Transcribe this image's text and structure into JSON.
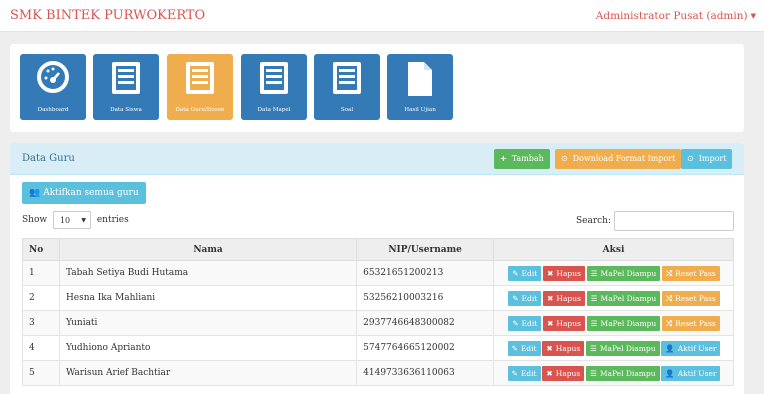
{
  "header": {
    "brand": "SMK BINTEK PURWOKERTO",
    "user": "Administrator Pusat (admin)"
  },
  "tiles": [
    {
      "label": "Dashboard",
      "icon": "dashboard-icon",
      "active": false
    },
    {
      "label": "Data Siswa",
      "icon": "list-icon",
      "active": false
    },
    {
      "label": "Data Guru/Dosen",
      "icon": "list-icon",
      "active": true
    },
    {
      "label": "Data Mapel",
      "icon": "list-icon",
      "active": false
    },
    {
      "label": "Soal",
      "icon": "list-icon",
      "active": false
    },
    {
      "label": "Hasil Ujian",
      "icon": "file-icon",
      "active": false
    }
  ],
  "panel": {
    "title": "Data Guru",
    "tambah": "Tambah",
    "download": "Download Format Import",
    "import": "Import",
    "aktifkan": "Aktifkan semua guru"
  },
  "length": {
    "show": "Show",
    "value": "10",
    "entries": "entries"
  },
  "search": {
    "label": "Search:",
    "value": ""
  },
  "table": {
    "headers": [
      "No",
      "Nama",
      "NIP/Username",
      "Aksi"
    ],
    "rows": [
      {
        "no": "1",
        "nama": "Tabah Setiya Budi Hutama",
        "nip": "65321651200213",
        "actions": [
          "Edit",
          "Hapus",
          "MaPel Diampu",
          "Reset Pass"
        ]
      },
      {
        "no": "2",
        "nama": "Hesna Ika Mahliani",
        "nip": "53256210003216",
        "actions": [
          "Edit",
          "Hapus",
          "MaPel Diampu",
          "Reset Pass"
        ]
      },
      {
        "no": "3",
        "nama": "Yuniati",
        "nip": "2937746648300082",
        "actions": [
          "Edit",
          "Hapus",
          "MaPel Diampu",
          "Reset Pass"
        ]
      },
      {
        "no": "4",
        "nama": "Yudhiono Aprianto",
        "nip": "5747764665120002",
        "actions": [
          "Edit",
          "Hapus",
          "MaPel Diampu",
          "Aktif User"
        ]
      },
      {
        "no": "5",
        "nama": "Warisun Arief Bachtiar",
        "nip": "4149733636110063",
        "actions": [
          "Edit",
          "Hapus",
          "MaPel Diampu",
          "Aktif User"
        ]
      }
    ]
  },
  "colors": {
    "brand": "#d9534f",
    "primary": "#337ab7",
    "warning": "#f0ad4e",
    "success": "#5cb85c",
    "info": "#5bc0de",
    "danger": "#d9534f"
  }
}
